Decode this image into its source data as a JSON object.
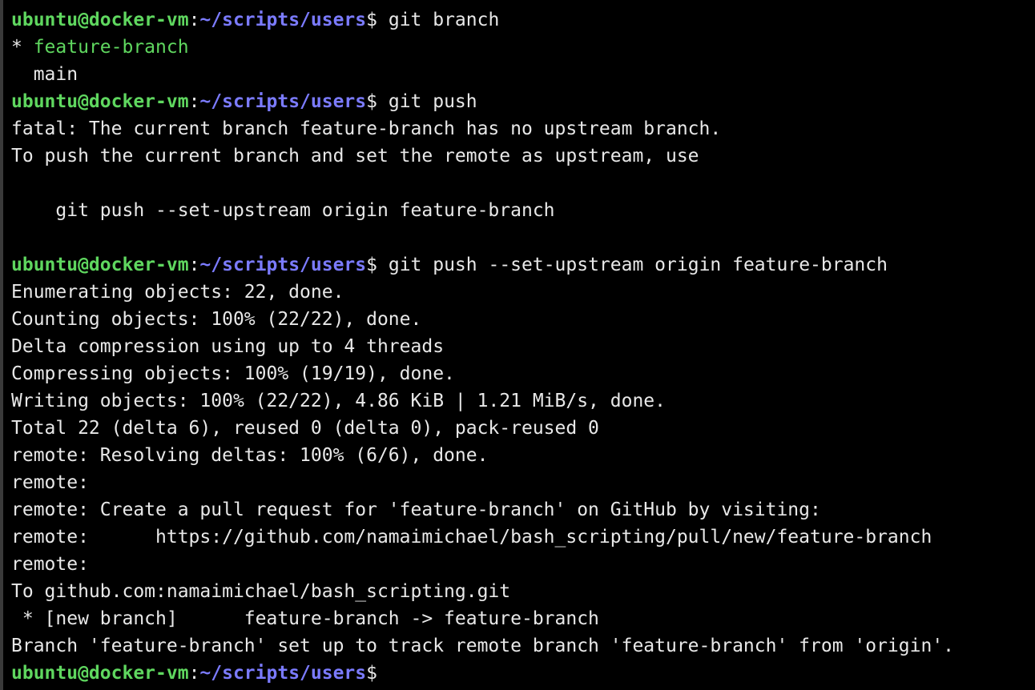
{
  "prompt": {
    "user_host": "ubuntu@docker-vm",
    "separator": ":",
    "path": "~/scripts/users",
    "symbol": "$ "
  },
  "lines": [
    {
      "type": "prompt",
      "cmd": "git branch"
    },
    {
      "type": "branch-current",
      "text": "* ",
      "branch": "feature-branch"
    },
    {
      "type": "text",
      "text": "  main"
    },
    {
      "type": "prompt",
      "cmd": "git push"
    },
    {
      "type": "text",
      "text": "fatal: The current branch feature-branch has no upstream branch."
    },
    {
      "type": "text",
      "text": "To push the current branch and set the remote as upstream, use"
    },
    {
      "type": "text",
      "text": ""
    },
    {
      "type": "text",
      "text": "    git push --set-upstream origin feature-branch"
    },
    {
      "type": "text",
      "text": ""
    },
    {
      "type": "prompt",
      "cmd": "git push --set-upstream origin feature-branch"
    },
    {
      "type": "text",
      "text": "Enumerating objects: 22, done."
    },
    {
      "type": "text",
      "text": "Counting objects: 100% (22/22), done."
    },
    {
      "type": "text",
      "text": "Delta compression using up to 4 threads"
    },
    {
      "type": "text",
      "text": "Compressing objects: 100% (19/19), done."
    },
    {
      "type": "text",
      "text": "Writing objects: 100% (22/22), 4.86 KiB | 1.21 MiB/s, done."
    },
    {
      "type": "text",
      "text": "Total 22 (delta 6), reused 0 (delta 0), pack-reused 0"
    },
    {
      "type": "text",
      "text": "remote: Resolving deltas: 100% (6/6), done."
    },
    {
      "type": "text",
      "text": "remote:"
    },
    {
      "type": "text",
      "text": "remote: Create a pull request for 'feature-branch' on GitHub by visiting:"
    },
    {
      "type": "text",
      "text": "remote:      https://github.com/namaimichael/bash_scripting/pull/new/feature-branch"
    },
    {
      "type": "text",
      "text": "remote:"
    },
    {
      "type": "text",
      "text": "To github.com:namaimichael/bash_scripting.git"
    },
    {
      "type": "text",
      "text": " * [new branch]      feature-branch -> feature-branch"
    },
    {
      "type": "text",
      "text": "Branch 'feature-branch' set up to track remote branch 'feature-branch' from 'origin'."
    },
    {
      "type": "prompt",
      "cmd": ""
    }
  ],
  "colors": {
    "background": "#000000",
    "text": "#e8e8e8",
    "user_host": "#5fd75f",
    "path": "#7b7bff",
    "current_branch": "#5fd75f"
  }
}
